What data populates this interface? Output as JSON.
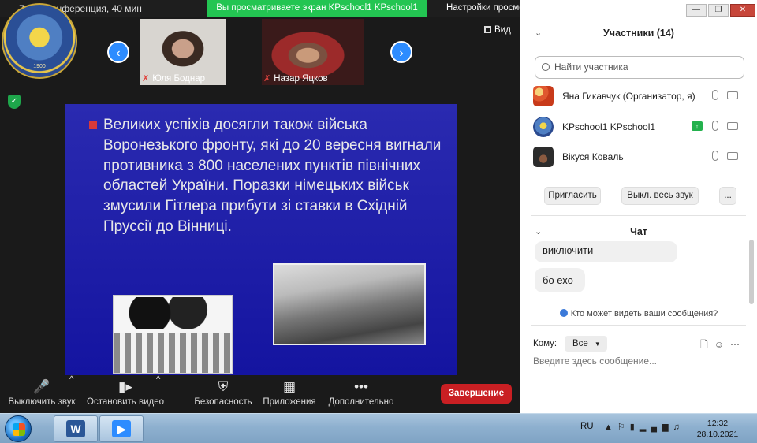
{
  "window": {
    "title": "Zoom Конференция, 40 мин",
    "share_banner": "Вы просматриваете экран KPschool1 KPschool1",
    "view_settings": "Настройки просмотра",
    "view_label": "Вид",
    "controls": {
      "minimize": "—",
      "maximize": "❐",
      "close": "✕"
    }
  },
  "logo": {
    "caption": "1900"
  },
  "videos": [
    {
      "name": "Юля Боднар"
    },
    {
      "name": "Назар Яцков"
    }
  ],
  "slide": {
    "text": "Великих успіхів досягли також війська Воронезького фронту, які до 20 вересня вигнали противника з 800 населених пунктів північних областей України. Поразки німецьких військ змусили Гітлера прибути зі ставки в Східній Пруссії до Вінниці."
  },
  "toolbar": {
    "mute": "Выключить звук",
    "video": "Остановить видео",
    "security": "Безопасность",
    "apps": "Приложения",
    "more": "Дополнительно",
    "end": "Завершение"
  },
  "participants": {
    "header": "Участники (14)",
    "search_placeholder": "Найти участника",
    "list": [
      {
        "name": "Яна Гикавчук (Организатор, я)"
      },
      {
        "name": "KPschool1 KPschool1"
      },
      {
        "name": "Вікуся Коваль"
      }
    ],
    "invite": "Пригласить",
    "mute_all": "Выкл. весь звук",
    "more": "..."
  },
  "chat": {
    "header": "Чат",
    "messages": [
      "виключити",
      "бо ехо"
    ],
    "who_can_see": "Кто может видеть ваши сообщения?",
    "to_label": "Кому:",
    "to_value": "Все",
    "input_placeholder": "Введите здесь сообщение..."
  },
  "taskbar": {
    "lang": "RU",
    "time": "12:32",
    "date": "28.10.2021",
    "apps": [
      {
        "label": "W",
        "color": "#2b5797"
      },
      {
        "label": "▶",
        "color": "#2d8cff"
      }
    ]
  }
}
